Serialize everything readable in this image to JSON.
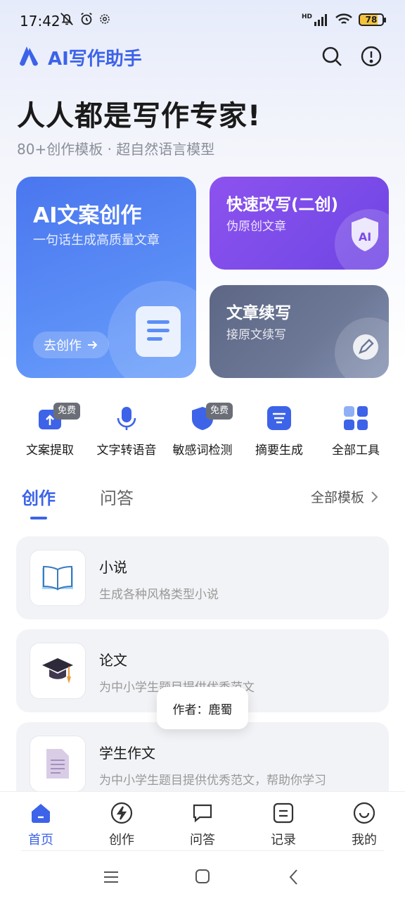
{
  "status_bar": {
    "time": "17:42",
    "battery": "78",
    "network": "HD"
  },
  "header": {
    "app_title": "AI写作助手",
    "icons": [
      "search-icon",
      "info-icon"
    ]
  },
  "hero": {
    "title": "人人都是写作专家!",
    "subtitle": "80+创作模板 · 超自然语言模型"
  },
  "cards": {
    "main": {
      "title": "AI文案创作",
      "subtitle": "一句话生成高质量文章",
      "button": "去创作"
    },
    "rewrite": {
      "title": "快速改写(二创)",
      "subtitle": "伪原创文章",
      "badge": "AI"
    },
    "continue": {
      "title": "文章续写",
      "subtitle": "接原文续写"
    }
  },
  "tools": [
    {
      "label": "文案提取",
      "badge": "免费",
      "icon": "upload-icon"
    },
    {
      "label": "文字转语音",
      "badge": "",
      "icon": "microphone-icon"
    },
    {
      "label": "敏感词检测",
      "badge": "免费",
      "icon": "shield-icon"
    },
    {
      "label": "摘要生成",
      "badge": "",
      "icon": "summary-icon"
    },
    {
      "label": "全部工具",
      "badge": "",
      "icon": "grid-icon"
    }
  ],
  "tabs": {
    "active": "创作",
    "inactive": "问答",
    "all_templates": "全部模板"
  },
  "templates": [
    {
      "title": "小说",
      "desc": "生成各种风格类型小说",
      "icon": "book-icon"
    },
    {
      "title": "论文",
      "desc": "为中小学生题目提供优秀范文",
      "icon": "graduation-cap-icon"
    },
    {
      "title": "学生作文",
      "desc": "为中小学生题目提供优秀范文，帮助你学习",
      "icon": "document-icon"
    }
  ],
  "toast": "作者：鹿蜀",
  "bottom_nav": [
    {
      "label": "首页",
      "active": true
    },
    {
      "label": "创作",
      "active": false
    },
    {
      "label": "问答",
      "active": false
    },
    {
      "label": "记录",
      "active": false
    },
    {
      "label": "我的",
      "active": false
    }
  ],
  "colors": {
    "accent": "#3d63e8",
    "card_main": "#5b8ef6",
    "card_rewrite": "#7a4be8",
    "card_continue": "#6d7897"
  }
}
